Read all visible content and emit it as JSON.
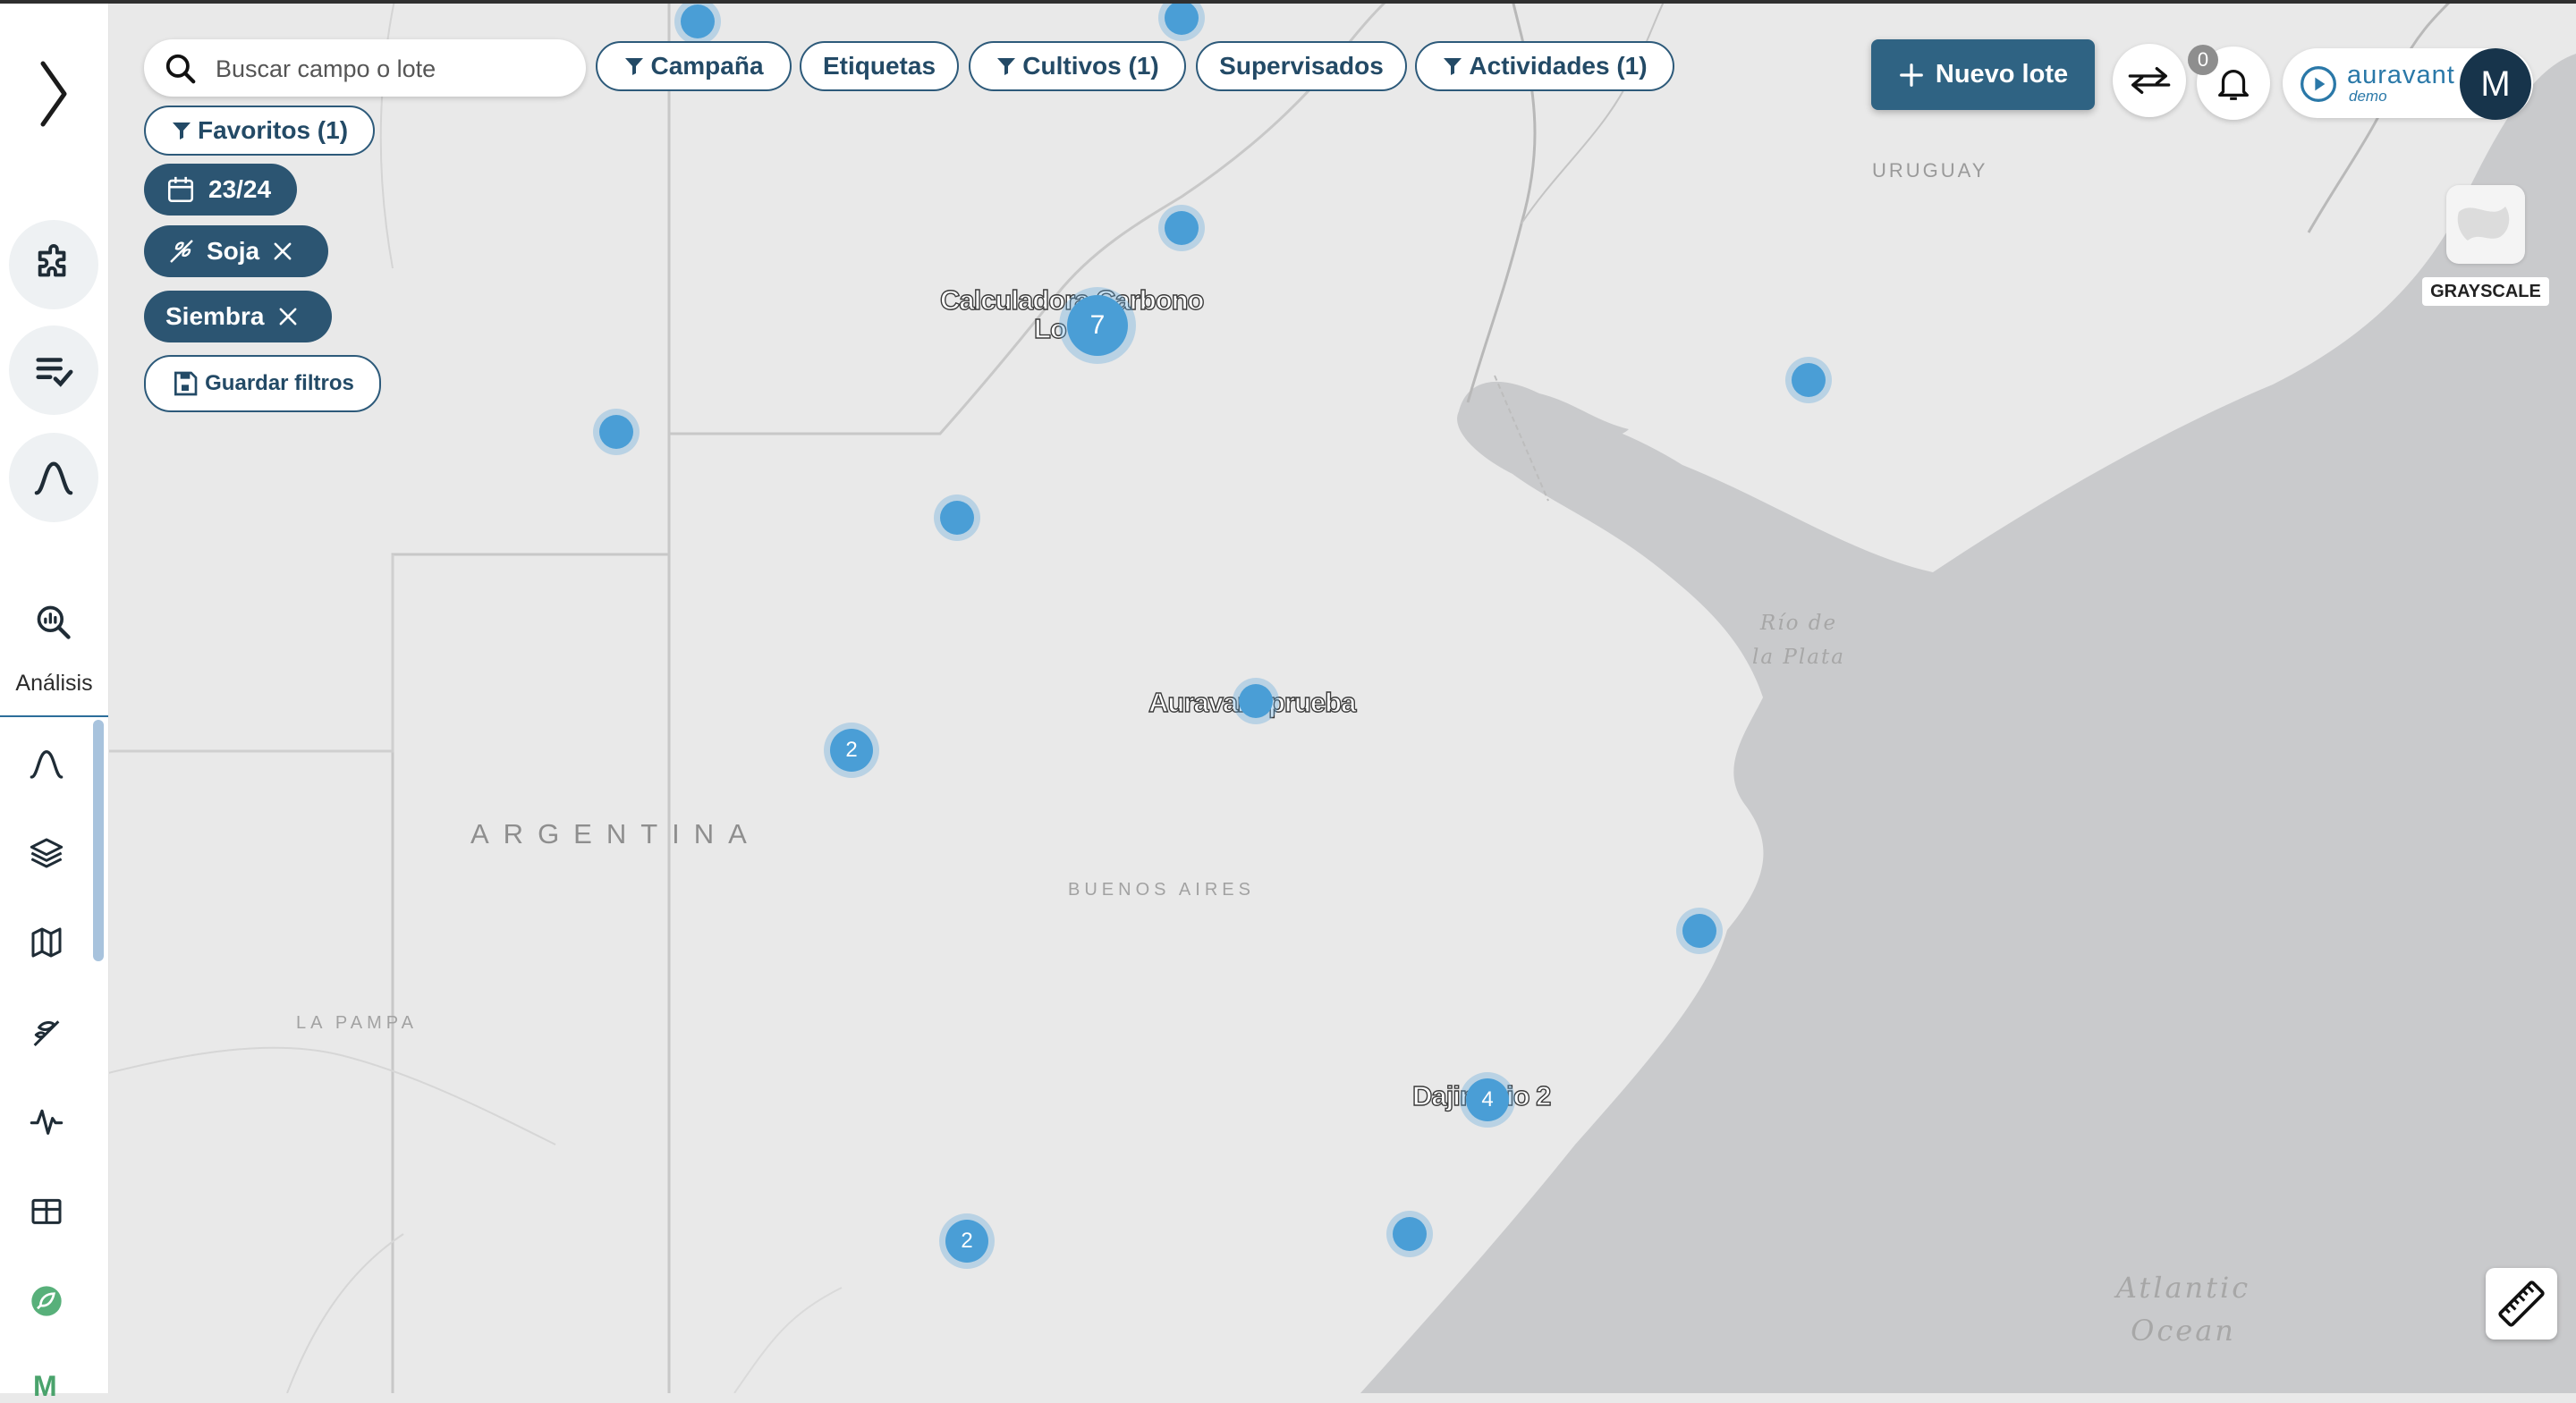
{
  "search": {
    "placeholder": "Buscar campo o lote"
  },
  "filters": {
    "campaign": "Campaña",
    "tags": "Etiquetas",
    "crops": "Cultivos (1)",
    "supervised": "Supervisados",
    "activities": "Actividades (1)",
    "favorites": "Favoritos (1)"
  },
  "active_filters": {
    "season": "23/24",
    "crop": "Soja",
    "activity": "Siembra",
    "save": "Guardar filtros"
  },
  "header": {
    "new_lot": "Nuevo lote",
    "notifications_count": "0",
    "brand_name": "auravant",
    "brand_sub": "demo",
    "avatar_initial": "M"
  },
  "basemap": {
    "style_label": "GRAYSCALE"
  },
  "sidebar": {
    "analysis_label": "Análisis",
    "bottom_initial": "M"
  },
  "map": {
    "country": "ARGENTINA",
    "province": "BUENOS AIRES",
    "province_west": "LA PAMPA",
    "neighbor": "URUGUAY",
    "river_line1": "Río de",
    "river_line2": "la Plata",
    "ocean_line1": "Atlantic",
    "ocean_line2": "Ocean"
  },
  "lots": {
    "label_a1": "Calculadora Carbono",
    "label_a2": "Lo",
    "label_b": "Auravant prueba",
    "label_c": "Dajindaio 2",
    "cluster_a": "7",
    "cluster_b": "2",
    "cluster_c": "4",
    "cluster_d": "2"
  },
  "colors": {
    "primary": "#2f6383",
    "chip_border": "#2d5a7a",
    "active_pill": "#2c5572",
    "marker": "#4a9ed6",
    "land": "#e9e9e9",
    "water": "#c9cacc"
  }
}
